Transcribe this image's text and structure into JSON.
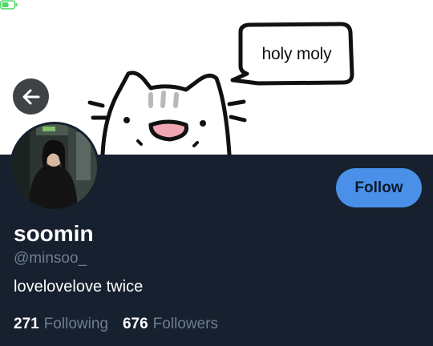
{
  "banner": {
    "speech_bubble_text": "holy moly"
  },
  "profile": {
    "display_name": "soomin",
    "handle": "@minsoo_",
    "bio": "lovelovelove twice",
    "follow_label": "Follow",
    "following_count": "271",
    "following_label": "Following",
    "followers_count": "676",
    "followers_label": "Followers"
  },
  "colors": {
    "background": "#16202e",
    "accent": "#4a90e8",
    "muted_text": "#6f7e8e"
  },
  "icons": {
    "back": "back-arrow-icon",
    "battery": "battery-icon"
  }
}
